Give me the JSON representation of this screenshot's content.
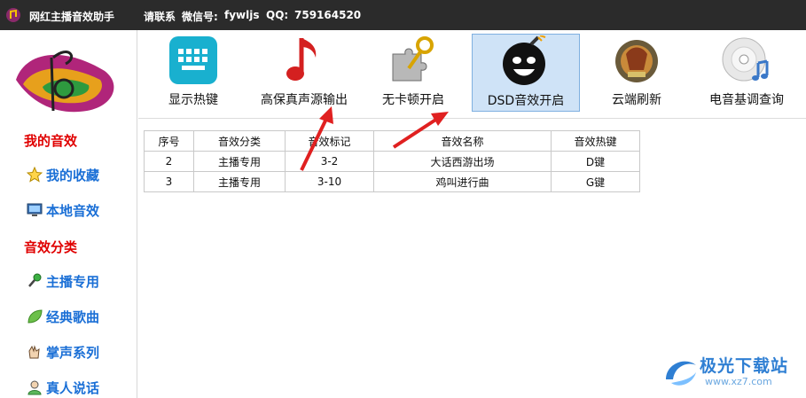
{
  "titlebar": {
    "title": "网红主播音效助手",
    "contact": "请联系",
    "wechat_label": "微信号:",
    "wechat_id": "fywljs",
    "qq_label": "QQ:",
    "qq_number": "759164520"
  },
  "sidebar": {
    "my_sounds_heading": "我的音效",
    "favorites": "我的收藏",
    "local_sounds": "本地音效",
    "category_heading": "音效分类",
    "categories": [
      "主播专用",
      "经典歌曲",
      "掌声系列",
      "真人说话"
    ]
  },
  "toolbar": {
    "buttons": [
      "显示热键",
      "高保真声源输出",
      "无卡顿开启",
      "DSD音效开启",
      "云端刷新",
      "电音基调查询"
    ],
    "active_index": 3
  },
  "table": {
    "headers": [
      "序号",
      "音效分类",
      "音效标记",
      "音效名称",
      "音效热键"
    ],
    "rows": [
      [
        "2",
        "主播专用",
        "3-2",
        "大话西游出场",
        "D键"
      ],
      [
        "3",
        "主播专用",
        "3-10",
        "鸡叫进行曲",
        "G键"
      ]
    ]
  },
  "watermark": {
    "name": "极光下载站",
    "url": "www.xz7.com"
  },
  "colors": {
    "titlebar_bg": "#2b2b2b",
    "heading_red": "#e00000",
    "link_blue": "#1a6fd6",
    "active_tool_bg": "#cfe3f7",
    "arrow_red": "#e02020"
  }
}
